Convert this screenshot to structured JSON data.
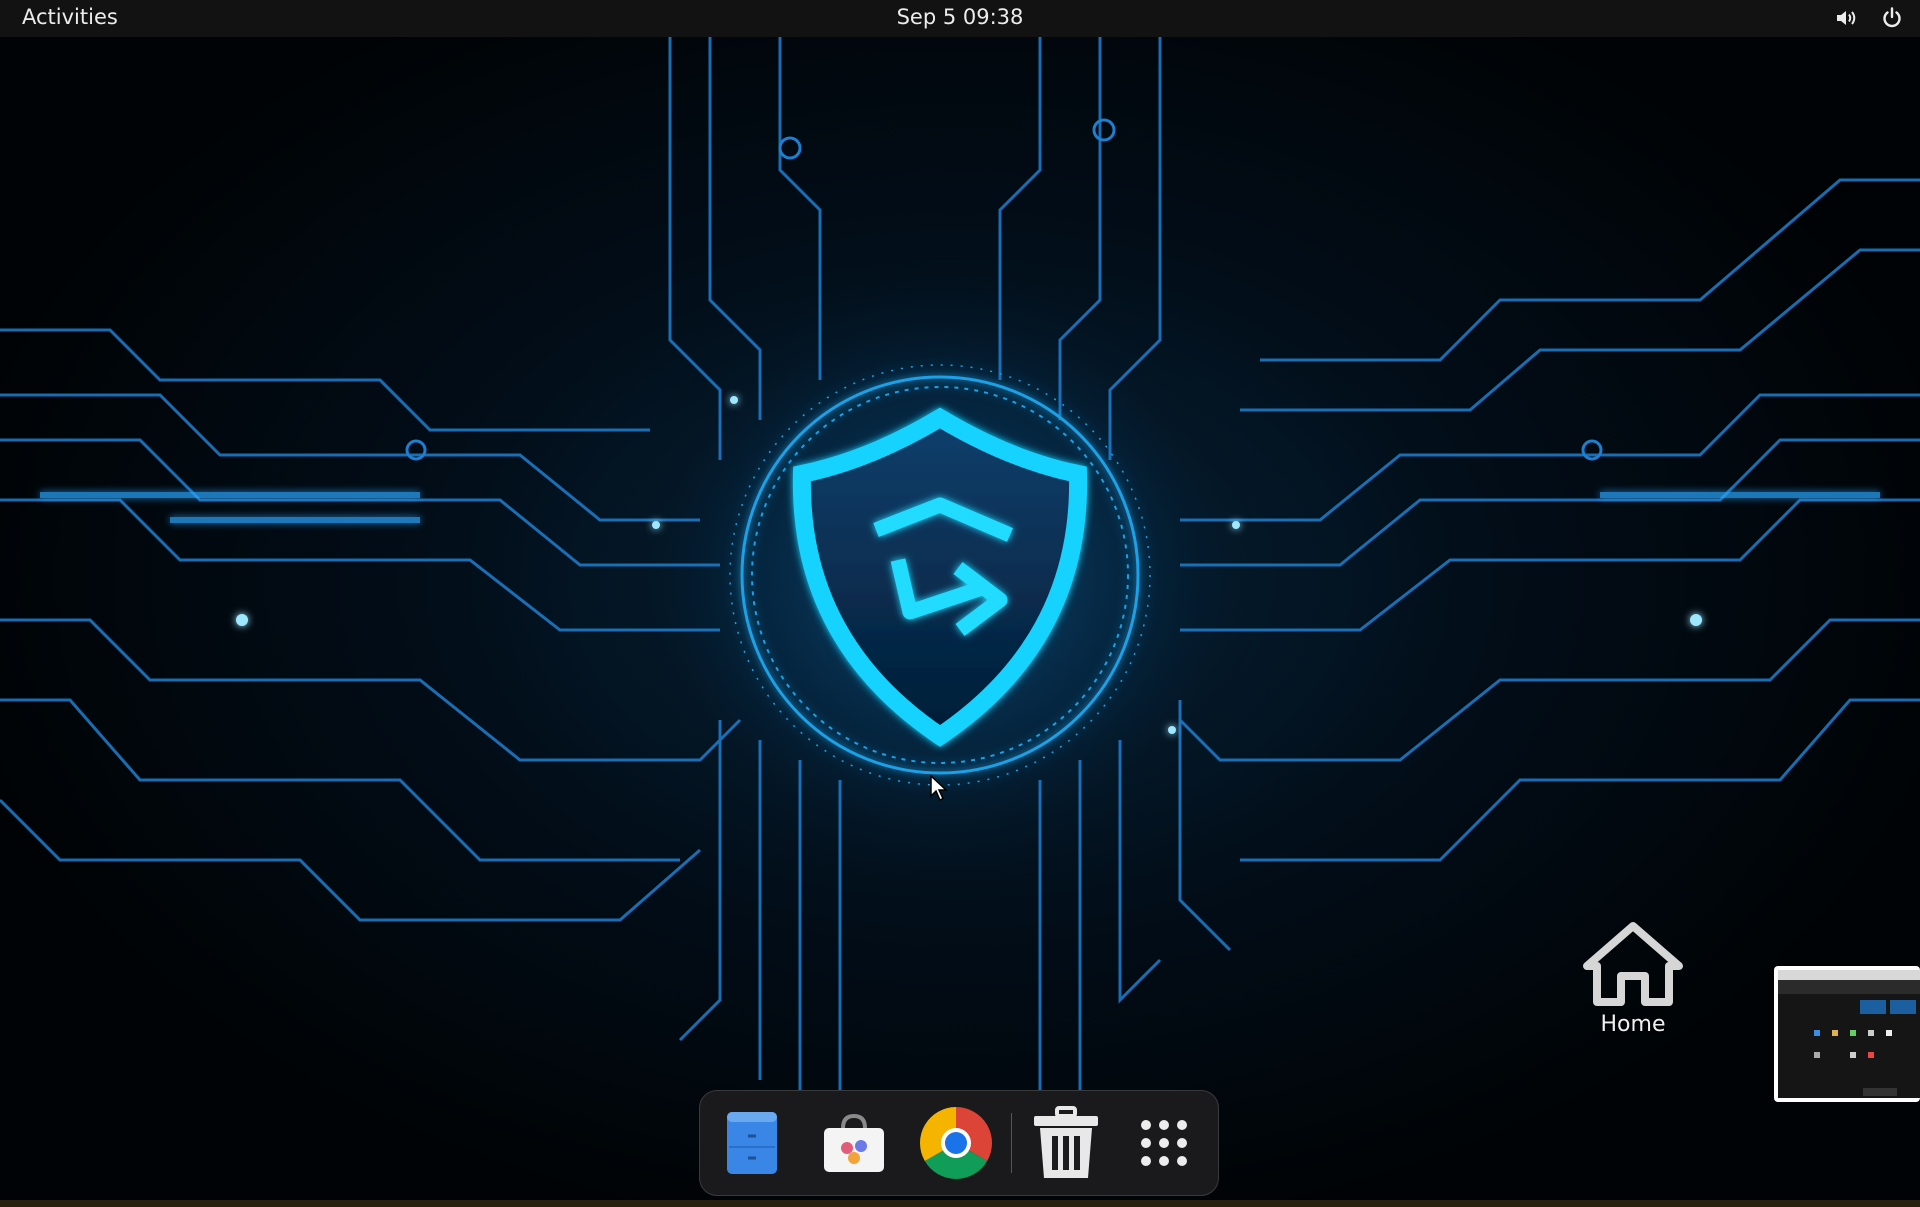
{
  "topbar": {
    "activities_label": "Activities",
    "clock": "Sep 5  09:38",
    "tray_icons": [
      "volume-icon",
      "power-icon"
    ]
  },
  "desktop": {
    "home_icon": {
      "label": "Home",
      "icon": "home-icon"
    }
  },
  "dock": {
    "items": [
      {
        "name": "files",
        "icon": "file-manager-icon"
      },
      {
        "name": "software",
        "icon": "software-store-icon"
      },
      {
        "name": "chrome",
        "icon": "chrome-icon"
      },
      {
        "name": "trash",
        "icon": "trash-icon"
      },
      {
        "name": "show-apps",
        "icon": "app-grid-icon"
      }
    ]
  },
  "colors": {
    "topbar": "#121212",
    "accent_glow": "#14d2ff",
    "circuit": "#1e7fd0",
    "dock_bg": "#1c1c1e"
  }
}
